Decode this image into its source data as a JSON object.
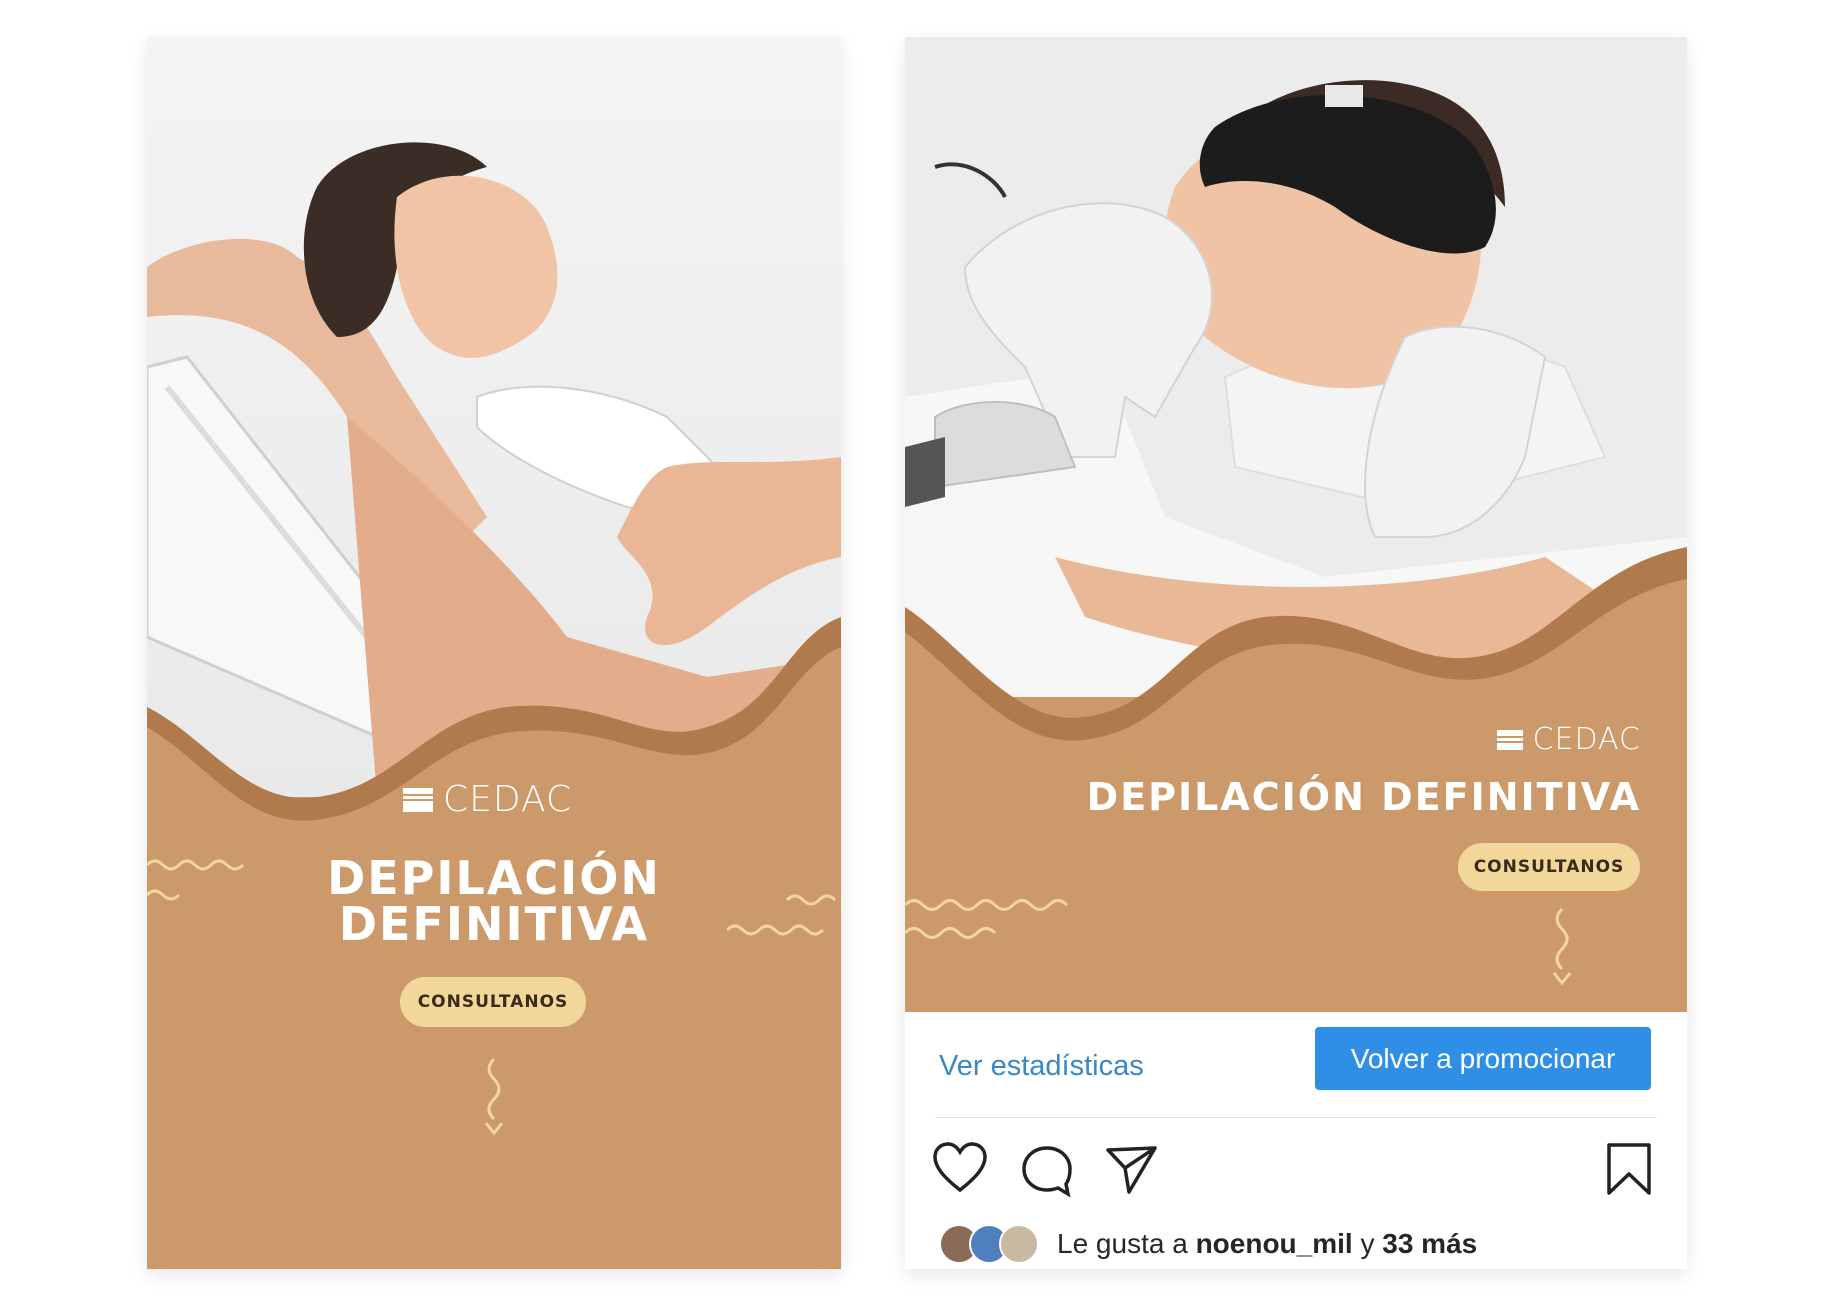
{
  "left_post": {
    "brand": "CEDAC",
    "headline_line1": "DEPILACIÓN",
    "headline_line2": "DEFINITIVA",
    "cta": "CONSULTANOS",
    "photo_icon": "woman-reclined-laser-hair-removal-photo"
  },
  "right_post": {
    "brand": "CEDAC",
    "headline": "DEPILACIÓN DEFINITIVA",
    "cta": "CONSULTANOS",
    "photo_icon": "woman-with-goggles-laser-treatment-photo",
    "view_stats": "Ver estadísticas",
    "promote_again": "Volver a promocionar",
    "likes_prefix": "Le gusta a ",
    "likes_user": "noenou_mil",
    "likes_middle": " y ",
    "likes_count": "33 más"
  },
  "colors": {
    "accent_tan": "#cc9a6a",
    "wave_brown": "#b07a4c",
    "cta_yellow": "#f1d79a",
    "instagram_blue": "#2f8fe6",
    "link_blue": "#3a87c7"
  },
  "icons": [
    "heart-icon",
    "comment-icon",
    "share-icon",
    "bookmark-icon",
    "arrow-down-squiggle-icon",
    "wavy-line-decoration"
  ]
}
